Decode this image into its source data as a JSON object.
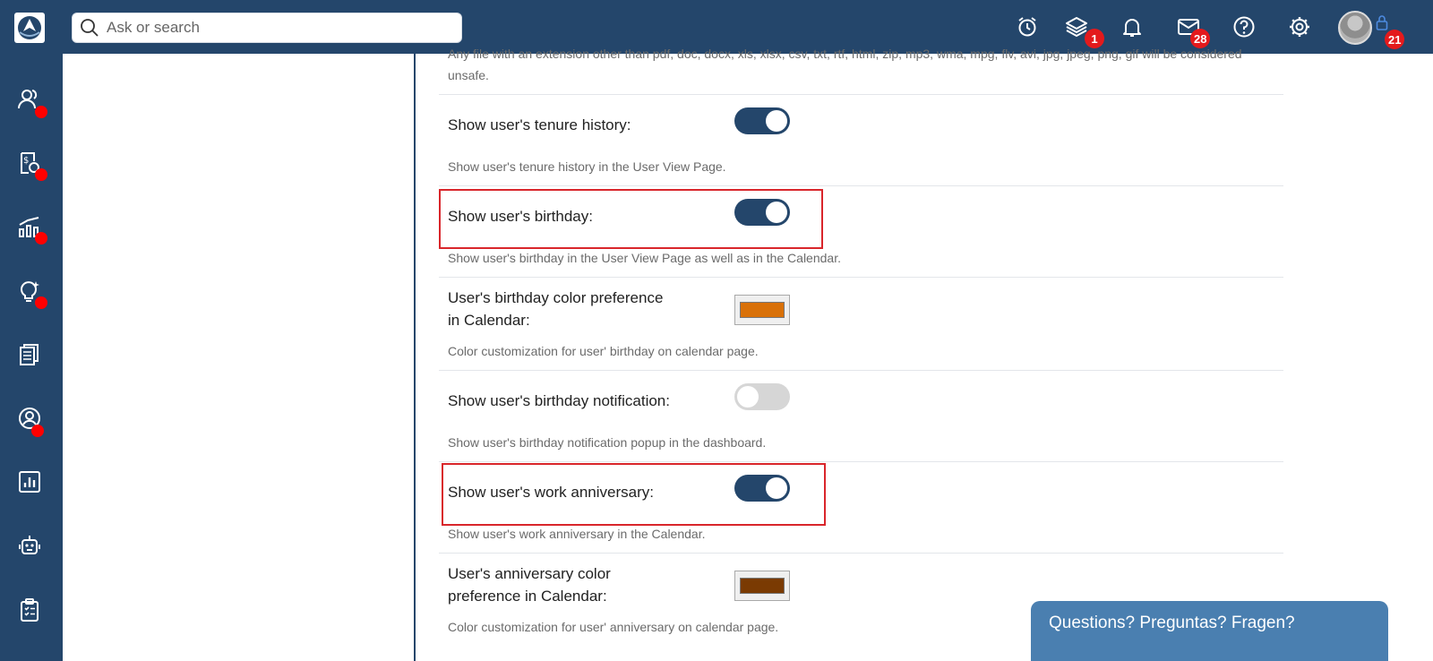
{
  "search": {
    "placeholder": "Ask or search"
  },
  "topbar": {
    "icons": [
      "alarm-clock-icon",
      "layers-icon",
      "bell-icon",
      "mail-icon",
      "help-icon",
      "gear-icon"
    ],
    "layers_badge": "1",
    "mail_badge": "28",
    "lock_badge": "21"
  },
  "sidebar": {
    "items": [
      "users-icon",
      "payroll-icon",
      "growth-chart-icon",
      "idea-bulb-icon",
      "documents-icon",
      "profile-icon",
      "report-chart-icon",
      "robot-icon",
      "checklist-icon"
    ]
  },
  "settings": {
    "top_desc_line1": "Any file with an extension other than pdf, doc, docx, xls, xlsx, csv, txt, rtf, html, zip, mp3, wma, mpg, flv, avi, jpg, jpeg, png, gif will be considered",
    "top_desc_line2": "unsafe.",
    "rows": [
      {
        "label": "Show user's tenure history:",
        "desc": "Show user's tenure history in the User View Page.",
        "state": "on"
      },
      {
        "label": "Show user's birthday:",
        "desc": "Show user's birthday in the User View Page as well as in the Calendar.",
        "state": "on"
      },
      {
        "label_line1": "User's birthday color preference",
        "label_line2": "in Calendar:",
        "desc": "Color customization for user' birthday on calendar page.",
        "color": "#d97109"
      },
      {
        "label": "Show user's birthday notification:",
        "desc": "Show user's birthday notification popup in the dashboard.",
        "state": "off"
      },
      {
        "label": "Show user's work anniversary:",
        "desc": "Show user's work anniversary in the Calendar.",
        "state": "on"
      },
      {
        "label_line1": "User's anniversary color",
        "label_line2": "preference in Calendar:",
        "desc": "Color customization for user' anniversary on calendar page.",
        "color": "#7a3a02"
      }
    ]
  },
  "chat": {
    "label": "Questions? Preguntas? Fragen?"
  }
}
